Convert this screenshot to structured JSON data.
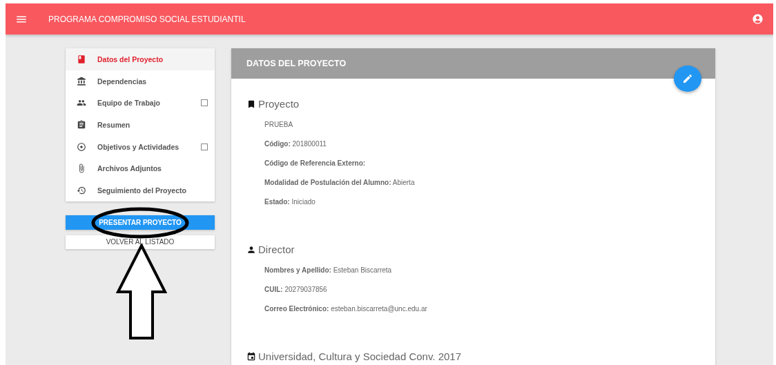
{
  "header": {
    "title": "PROGRAMA COMPROMISO SOCIAL ESTUDIANTIL"
  },
  "sidebar": {
    "items": [
      {
        "label": "Datos del Proyecto",
        "selected": true
      },
      {
        "label": "Dependencias",
        "selected": false
      },
      {
        "label": "Equipo de Trabajo",
        "selected": false,
        "checkbox": {
          "checked": false
        }
      },
      {
        "label": "Resumen",
        "selected": false
      },
      {
        "label": "Objetivos y Actividades",
        "selected": false,
        "checkbox": {
          "checked": false
        }
      },
      {
        "label": "Archivos Adjuntos",
        "selected": false
      },
      {
        "label": "Seguimiento del Proyecto",
        "selected": false
      }
    ]
  },
  "actions": [
    {
      "label": "PRESENTAR PROYECTO",
      "kind": "primary"
    },
    {
      "label": "VOLVER AL LISTADO",
      "kind": "secondary"
    }
  ],
  "panel": {
    "title": "DATOS DEL PROYECTO",
    "sections": [
      {
        "title": "Proyecto",
        "fields": [
          {
            "value": "PRUEBA"
          },
          {
            "label": "Código:",
            "value": "201800011"
          },
          {
            "label": "Código de Referencia Externo:"
          },
          {
            "label": "Modalidad de Postulación del Alumno:",
            "value": "Abierta"
          },
          {
            "label": "Estado:",
            "value": "Iniciado"
          }
        ]
      },
      {
        "title": "Director",
        "fields": [
          {
            "label": "Nombres y Apellido:",
            "value": "Esteban Biscarreta"
          },
          {
            "label": "CUIL:",
            "value": "20279037856"
          },
          {
            "label": "Correo Electrónico:",
            "value": "esteban.biscarreta@unc.edu.ar"
          }
        ]
      },
      {
        "title": "Universidad, Cultura y Sociedad Conv. 2017"
      }
    ]
  }
}
